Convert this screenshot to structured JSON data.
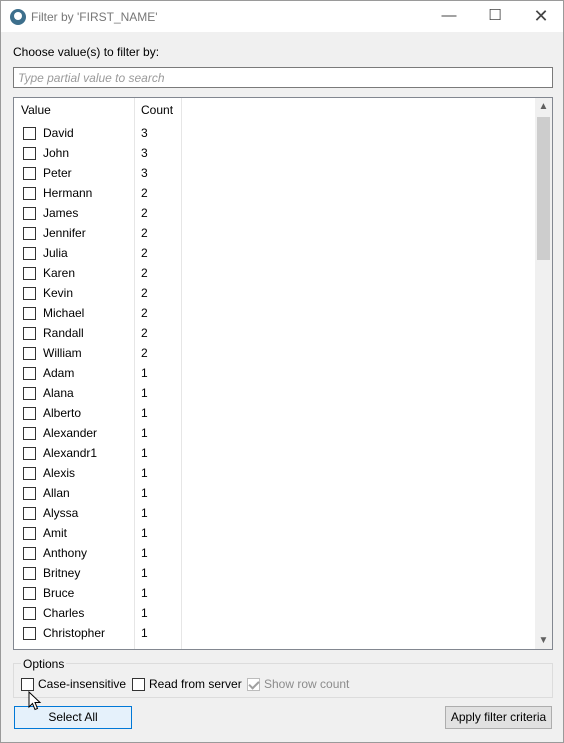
{
  "window": {
    "title": "Filter by 'FIRST_NAME'",
    "controls": {
      "minimize": "—",
      "maximize": "☐",
      "close": "✕"
    }
  },
  "filter": {
    "choose_label": "Choose value(s) to filter by:",
    "search_placeholder": "Type partial value to search",
    "search_value": ""
  },
  "list": {
    "headers": {
      "value": "Value",
      "count": "Count"
    },
    "items": [
      {
        "value": "David",
        "count": "3",
        "checked": false
      },
      {
        "value": "John",
        "count": "3",
        "checked": false
      },
      {
        "value": "Peter",
        "count": "3",
        "checked": false
      },
      {
        "value": "Hermann",
        "count": "2",
        "checked": false
      },
      {
        "value": "James",
        "count": "2",
        "checked": false
      },
      {
        "value": "Jennifer",
        "count": "2",
        "checked": false
      },
      {
        "value": "Julia",
        "count": "2",
        "checked": false
      },
      {
        "value": "Karen",
        "count": "2",
        "checked": false
      },
      {
        "value": "Kevin",
        "count": "2",
        "checked": false
      },
      {
        "value": "Michael",
        "count": "2",
        "checked": false
      },
      {
        "value": "Randall",
        "count": "2",
        "checked": false
      },
      {
        "value": "William",
        "count": "2",
        "checked": false
      },
      {
        "value": "Adam",
        "count": "1",
        "checked": false
      },
      {
        "value": "Alana",
        "count": "1",
        "checked": false
      },
      {
        "value": "Alberto",
        "count": "1",
        "checked": false
      },
      {
        "value": "Alexander",
        "count": "1",
        "checked": false
      },
      {
        "value": "Alexandr1",
        "count": "1",
        "checked": false
      },
      {
        "value": "Alexis",
        "count": "1",
        "checked": false
      },
      {
        "value": "Allan",
        "count": "1",
        "checked": false
      },
      {
        "value": "Alyssa",
        "count": "1",
        "checked": false
      },
      {
        "value": "Amit",
        "count": "1",
        "checked": false
      },
      {
        "value": "Anthony",
        "count": "1",
        "checked": false
      },
      {
        "value": "Britney",
        "count": "1",
        "checked": false
      },
      {
        "value": "Bruce",
        "count": "1",
        "checked": false
      },
      {
        "value": "Charles",
        "count": "1",
        "checked": false
      },
      {
        "value": "Christopher",
        "count": "1",
        "checked": false
      }
    ],
    "scroll_arrows": {
      "up": "▲",
      "down": "▼"
    }
  },
  "options": {
    "title": "Options",
    "case_insensitive": {
      "label": "Case-insensitive",
      "checked": false
    },
    "read_from_server": {
      "label": "Read from server",
      "checked": false
    },
    "show_row_count": {
      "label": "Show row count",
      "checked": true,
      "disabled": true
    }
  },
  "buttons": {
    "select_all": "Select All",
    "apply": "Apply filter criteria"
  },
  "icons": {
    "app": "app-logo-icon",
    "cursor": "mouse-pointer-icon"
  }
}
